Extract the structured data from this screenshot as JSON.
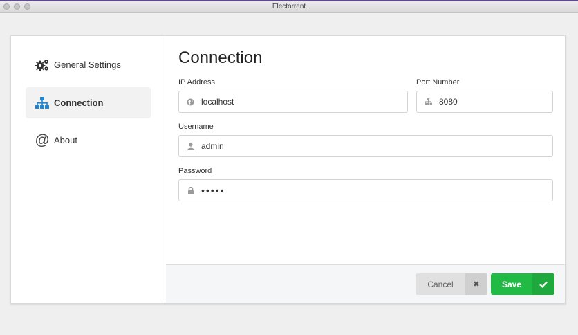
{
  "window": {
    "title": "Electorrent"
  },
  "sidebar": {
    "items": [
      {
        "label": "General Settings",
        "icon": "gears-icon"
      },
      {
        "label": "Connection",
        "icon": "sitemap-icon",
        "active": true
      },
      {
        "label": "About",
        "icon": "at-icon"
      }
    ]
  },
  "main": {
    "title": "Connection",
    "ip": {
      "label": "IP Address",
      "value": "localhost",
      "icon": "globe-icon"
    },
    "port": {
      "label": "Port Number",
      "value": "8080",
      "icon": "sitemap-icon"
    },
    "username": {
      "label": "Username",
      "value": "admin",
      "icon": "user-icon"
    },
    "password": {
      "label": "Password",
      "value": "•••••",
      "icon": "lock-icon"
    }
  },
  "footer": {
    "cancel_label": "Cancel",
    "save_label": "Save"
  },
  "colors": {
    "accent": "#2185d0",
    "save": "#21ba45"
  }
}
